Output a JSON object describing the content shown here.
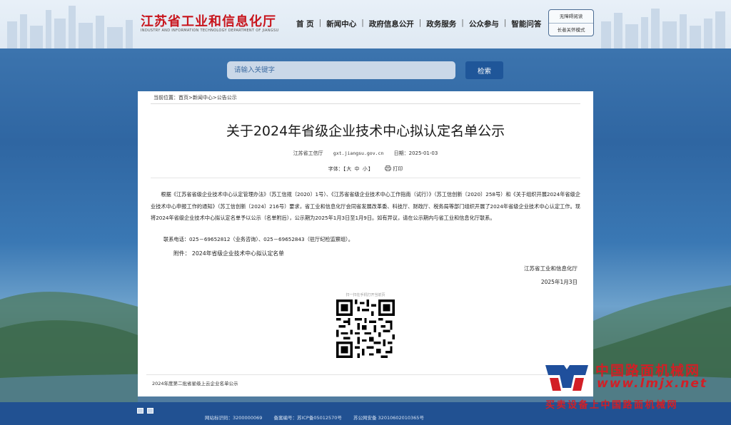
{
  "header": {
    "logo_cn": "江苏省工业和信息化厅",
    "logo_en": "INDUSTRY AND INFORMATION TECHNOLOGY DEPARTMENT OF JIANGSU",
    "nav": [
      "首 页",
      "新闻中心",
      "政府信息公开",
      "政务服务",
      "公众参与",
      "智能问答"
    ],
    "accessibility": [
      "无障碍阅读",
      "长者关怀模式"
    ]
  },
  "search": {
    "placeholder": "请输入关键字",
    "button": "检索"
  },
  "breadcrumb": {
    "prefix": "当前位置：",
    "items": [
      "首页",
      "新闻中心",
      "公告公示"
    ]
  },
  "article": {
    "title": "关于2024年省级企业技术中心拟认定名单公示",
    "source": "江苏省工信厅",
    "site": "gxt.jiangsu.gov.cn",
    "date": "日期：2025-01-03",
    "font_label": "字体：【",
    "font_sizes": [
      "大",
      "中",
      "小"
    ],
    "font_close": "】",
    "print": "打印",
    "body": "根据《江苏省省级企业技术中心认定管理办法》（苏工信规〔2020〕1号）、《江苏省省级企业技术中心工作指南（试行）》（苏工信创新〔2020〕258号）和《关于组织开展2024年省级企业技术中心申报工作的通知》（苏工信创新〔2024〕216号）要求，省工业和信息化厅会同省发展改革委、科技厅、财政厅、税务局等部门组织开展了2024年省级企业技术中心认定工作。现将2024年省级企业技术中心拟认定名单予以公示（名单附后），公示期为2025年1月3日至1月9日。如有异议，请在公示期内与省工业和信息化厅联系。",
    "contact": "联系电话：025－69652812（业务咨询）、025－69652843（驻厅纪检监察组）。",
    "attachment_label": "附件：",
    "attachment": "2024年省级企业技术中心拟认定名单",
    "sign_org": "江苏省工业和信息化厅",
    "sign_date": "2025年1月3日",
    "qr_caption": "扫一扫在手机打开当前页",
    "related": "2024年度第二批省星级上云企业名单公示"
  },
  "footer": {
    "site_code": "网站标识码：3200000069",
    "icp": "备案编号：苏ICP备05012570号",
    "police": "苏公网安备 32010602010365号"
  },
  "watermark": {
    "cn": "中国路面机械网",
    "url": "www.lmjx.net",
    "sub": "买卖设备上中国路面机械网"
  }
}
